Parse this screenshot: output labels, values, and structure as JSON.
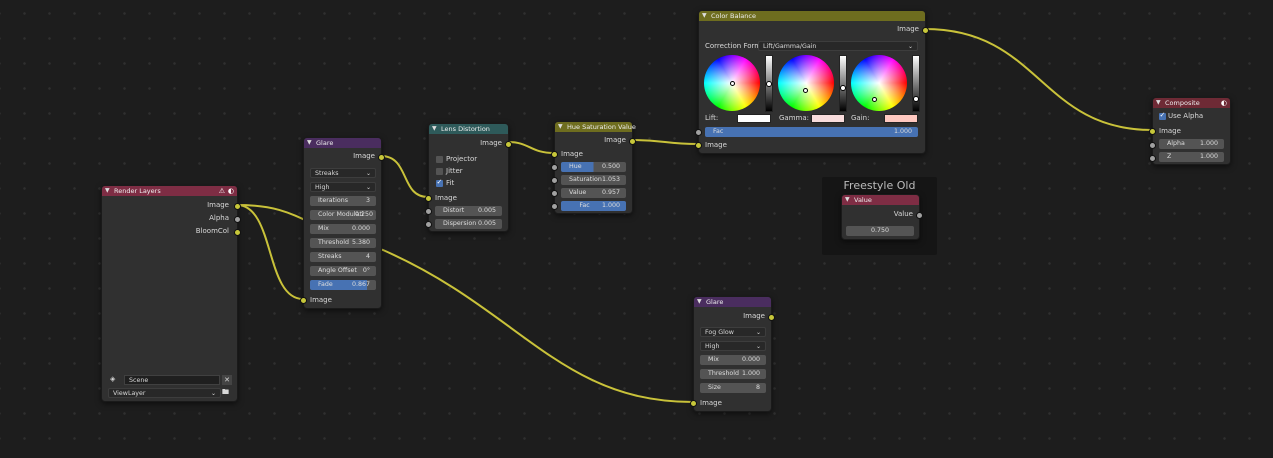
{
  "colors": {
    "input_header": "#7e2d44",
    "filter_header": "#4a2d5f",
    "distort_header": "#2e5a5a",
    "color_header": "#6e6d1f",
    "output_header": "#6e2a35",
    "wire": "#c9c23a",
    "field_blue": "#4772b3"
  },
  "render_layers": {
    "title": "Render Layers",
    "outputs": [
      "Image",
      "Alpha",
      "BloomCol"
    ],
    "scene_value": "Scene",
    "view_layer_value": "ViewLayer",
    "icons": [
      "warning-icon",
      "render-icon",
      "scene-icon",
      "close-icon",
      "folder-icon"
    ]
  },
  "glare1": {
    "title": "Glare",
    "output": "Image",
    "type": "Streaks",
    "quality": "High",
    "iterations_label": "Iterations",
    "iterations_value": "3",
    "color_mod_label": "Color Modulati",
    "color_mod_value": "0.250",
    "mix_label": "Mix",
    "mix_value": "0.000",
    "threshold_label": "Threshold",
    "threshold_value": "5.380",
    "streaks_label": "Streaks",
    "streaks_value": "4",
    "angle_label": "Angle Offset",
    "angle_value": "0°",
    "fade_label": "Fade",
    "fade_value": "0.867",
    "fade_fill": 0.867,
    "input": "Image"
  },
  "lens": {
    "title": "Lens Distortion",
    "output": "Image",
    "projector": "Projector",
    "projector_checked": false,
    "jitter": "Jitter",
    "jitter_checked": false,
    "fit": "Fit",
    "fit_checked": true,
    "input": "Image",
    "distort_label": "Distort",
    "distort_value": "0.005",
    "dispersion_label": "Dispersion",
    "dispersion_value": "0.005"
  },
  "hsv": {
    "title": "Hue Saturation Value",
    "output": "Image",
    "input": "Image",
    "hue_label": "Hue",
    "hue_value": "0.500",
    "hue_fill": 0.5,
    "sat_label": "Saturation",
    "sat_value": "1.053",
    "val_label": "Value",
    "val_value": "0.957",
    "fac_label": "Fac",
    "fac_value": "1.000",
    "fac_fill": 1.0
  },
  "color_balance": {
    "title": "Color Balance",
    "output": "Image",
    "formula_label": "Correction Formula:",
    "formula_value": "Lift/Gamma/Gain",
    "lift_label": "Lift:",
    "lift_color": "#ffffff",
    "gamma_label": "Gamma:",
    "gamma_color": "#f8dcdc",
    "gain_label": "Gain:",
    "gain_color": "#ffc8c0",
    "fac_label": "Fac",
    "fac_value": "1.000",
    "fac_fill": 1.0,
    "input": "Image"
  },
  "composite": {
    "title": "Composite",
    "use_alpha_label": "Use Alpha",
    "use_alpha_checked": true,
    "input_image": "Image",
    "alpha_label": "Alpha",
    "alpha_value": "1.000",
    "z_label": "Z",
    "z_value": "1.000"
  },
  "frame": {
    "title": "Freestyle Old",
    "value_node_title": "Value",
    "value_output": "Value",
    "value_value": "0.750"
  },
  "glare2": {
    "title": "Glare",
    "output": "Image",
    "type": "Fog Glow",
    "quality": "High",
    "mix_label": "Mix",
    "mix_value": "0.000",
    "threshold_label": "Threshold",
    "threshold_value": "1.000",
    "size_label": "Size",
    "size_value": "8",
    "input": "Image"
  }
}
